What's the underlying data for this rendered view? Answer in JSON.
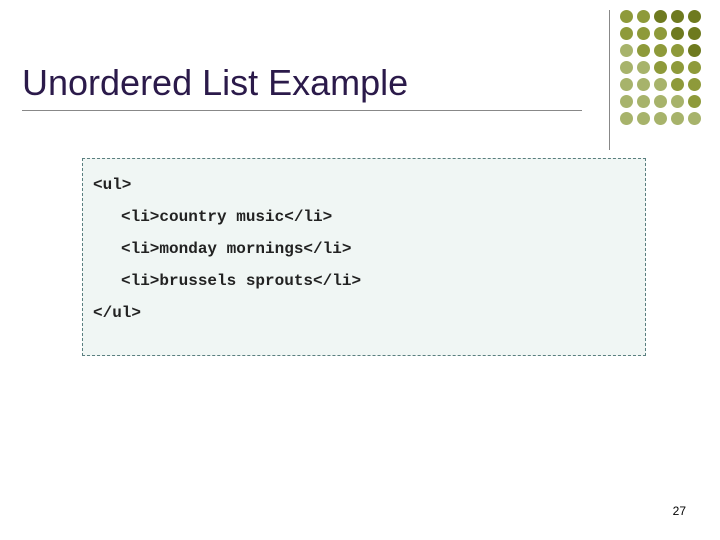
{
  "title": "Unordered List Example",
  "code": {
    "open_ul": "<ul>",
    "li1": "<li>country music</li>",
    "li2": "<li>monday mornings</li>",
    "li3": "<li>brussels sprouts</li>",
    "close_ul": "</ul>"
  },
  "page_number": "27",
  "decor_colors": {
    "muted": "#a7b36b",
    "olive": "#8e9a3a",
    "dark_olive": "#6e7a1f"
  }
}
